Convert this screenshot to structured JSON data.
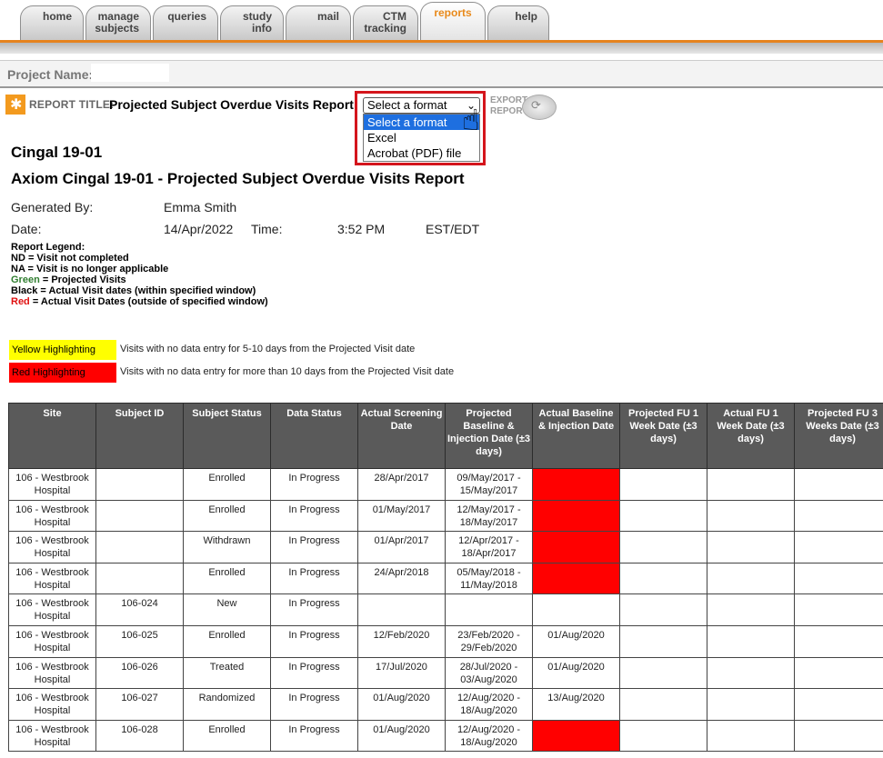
{
  "tabs": [
    {
      "label": "home",
      "active": false
    },
    {
      "label": "manage subjects",
      "active": false
    },
    {
      "label": "queries",
      "active": false
    },
    {
      "label": "study info",
      "active": false
    },
    {
      "label": "mail",
      "active": false
    },
    {
      "label": "CTM tracking",
      "active": false
    },
    {
      "label": "reports",
      "active": true
    },
    {
      "label": "help",
      "active": false
    }
  ],
  "project": {
    "label": "Project Name:",
    "value": ""
  },
  "report_title": {
    "label": "REPORT TITLE:",
    "value": "Projected Subject Overdue Visits Report"
  },
  "format_select": {
    "current": "Select a format",
    "options": [
      {
        "label": "Select a format",
        "highlighted": true
      },
      {
        "label": "Excel",
        "highlighted": false
      },
      {
        "label": "Acrobat (PDF) file",
        "highlighted": false
      }
    ]
  },
  "export": {
    "line1": "EXPORT",
    "line2": "REPORT"
  },
  "heading": {
    "study": "Cingal 19-01",
    "report": "Axiom Cingal 19-01 - Projected Subject Overdue Visits Report"
  },
  "meta": {
    "generated_by_label": "Generated By:",
    "generated_by": "Emma Smith",
    "date_label": "Date:",
    "date": "14/Apr/2022",
    "time_label": "Time:",
    "time": "3:52 PM",
    "tz": "EST/EDT"
  },
  "legend": {
    "title": "Report Legend:",
    "nd": "ND = Visit not completed",
    "na": "NA = Visit is no longer applicable",
    "green_word": "Green",
    "green_rest": " = Projected Visits",
    "black": "Black = Actual Visit dates (within specified window)",
    "red_word": "Red",
    "red_rest": " = Actual Visit Dates (outside of specified window)"
  },
  "highlights": {
    "yellow_label": "Yellow Highlighting",
    "yellow_desc": "Visits with no data entry for 5-10 days from the Projected Visit date",
    "red_label": "Red Highlighting",
    "red_desc": "Visits with no data entry for more than 10 days from the Projected Visit date"
  },
  "colors": {
    "tab_accent": "#e6831e",
    "highlight_red": "#ff0000",
    "highlight_yellow": "#ffff00",
    "projected_green": "#2f7d2f",
    "header_bg": "#5a5a5a"
  },
  "table": {
    "headers": [
      "Site",
      "Subject ID",
      "Subject Status",
      "Data Status",
      "Actual Screening Date",
      "Projected Baseline & Injection Date (±3 days)",
      "Actual Baseline & Injection Date",
      "Projected FU 1 Week Date (±3 days)",
      "Actual FU 1 Week Date (±3 days)",
      "Projected FU 3 Weeks Date (±3 days)"
    ],
    "rows": [
      {
        "site": "106 - Westbrook Hospital",
        "subject_id": "",
        "status": "Enrolled",
        "data_status": "In Progress",
        "screening": "28/Apr/2017",
        "proj_baseline": "09/May/2017 - 15/May/2017",
        "actual_baseline": "",
        "actual_flag": "red",
        "proj_fu1": "",
        "actual_fu1": "",
        "proj_fu3": ""
      },
      {
        "site": "106 - Westbrook Hospital",
        "subject_id": "",
        "status": "Enrolled",
        "data_status": "In Progress",
        "screening": "01/May/2017",
        "proj_baseline": "12/May/2017 - 18/May/2017",
        "actual_baseline": "",
        "actual_flag": "red",
        "proj_fu1": "",
        "actual_fu1": "",
        "proj_fu3": ""
      },
      {
        "site": "106 - Westbrook Hospital",
        "subject_id": "",
        "status": "Withdrawn",
        "data_status": "In Progress",
        "screening": "01/Apr/2017",
        "proj_baseline": "12/Apr/2017 - 18/Apr/2017",
        "actual_baseline": "",
        "actual_flag": "red",
        "proj_fu1": "",
        "actual_fu1": "",
        "proj_fu3": ""
      },
      {
        "site": "106 - Westbrook Hospital",
        "subject_id": "",
        "status": "Enrolled",
        "data_status": "In Progress",
        "screening": "24/Apr/2018",
        "proj_baseline": "05/May/2018 - 11/May/2018",
        "actual_baseline": "",
        "actual_flag": "red",
        "proj_fu1": "",
        "actual_fu1": "",
        "proj_fu3": ""
      },
      {
        "site": "106 - Westbrook Hospital",
        "subject_id": "106-024",
        "status": "New",
        "data_status": "In Progress",
        "screening": "",
        "proj_baseline": "",
        "actual_baseline": "",
        "actual_flag": "none",
        "proj_fu1": "",
        "actual_fu1": "",
        "proj_fu3": ""
      },
      {
        "site": "106 - Westbrook Hospital",
        "subject_id": "106-025",
        "status": "Enrolled",
        "data_status": "In Progress",
        "screening": "12/Feb/2020",
        "proj_baseline": "23/Feb/2020 - 29/Feb/2020",
        "actual_baseline": "01/Aug/2020",
        "actual_flag": "late",
        "proj_fu1": "",
        "actual_fu1": "",
        "proj_fu3": ""
      },
      {
        "site": "106 - Westbrook Hospital",
        "subject_id": "106-026",
        "status": "Treated",
        "data_status": "In Progress",
        "screening": "17/Jul/2020",
        "proj_baseline": "28/Jul/2020 - 03/Aug/2020",
        "actual_baseline": "01/Aug/2020",
        "actual_flag": "none",
        "proj_fu1": "",
        "actual_fu1": "",
        "proj_fu3": ""
      },
      {
        "site": "106 - Westbrook Hospital",
        "subject_id": "106-027",
        "status": "Randomized",
        "data_status": "In Progress",
        "screening": "01/Aug/2020",
        "proj_baseline": "12/Aug/2020 - 18/Aug/2020",
        "actual_baseline": "13/Aug/2020",
        "actual_flag": "none",
        "proj_fu1": "",
        "actual_fu1": "",
        "proj_fu3": ""
      },
      {
        "site": "106 - Westbrook Hospital",
        "subject_id": "106-028",
        "status": "Enrolled",
        "data_status": "In Progress",
        "screening": "01/Aug/2020",
        "proj_baseline": "12/Aug/2020 - 18/Aug/2020",
        "actual_baseline": "",
        "actual_flag": "red",
        "proj_fu1": "",
        "actual_fu1": "",
        "proj_fu3": ""
      }
    ]
  }
}
